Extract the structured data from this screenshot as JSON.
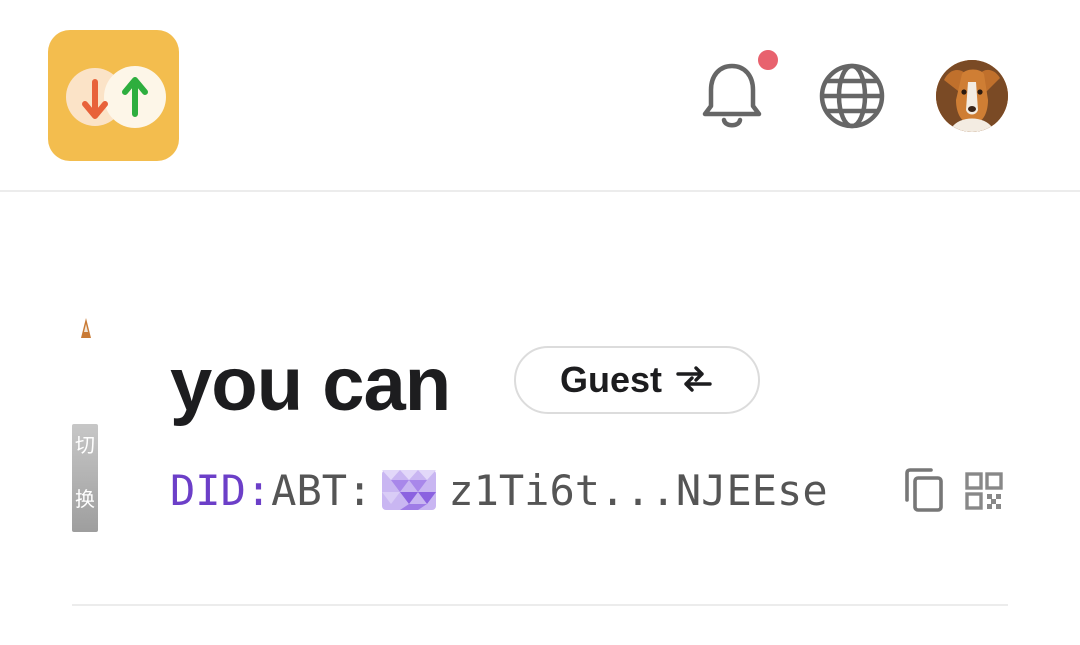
{
  "header": {
    "logo_icon": "swap-arrows-logo-icon",
    "notifications": {
      "icon": "bell-icon",
      "has_unread": true,
      "dot_color": "#e8626e"
    },
    "language": {
      "icon": "globe-icon"
    },
    "profile": {
      "icon": "user-avatar-dog"
    }
  },
  "user": {
    "name": "you can",
    "role_label": "Guest",
    "role_switch_icon": "swap-horizontal-icon",
    "did_prefix": "DID:",
    "did_type": "ABT:",
    "did_value": "z1Ti6t...NJEEse",
    "actions": {
      "copy_icon": "copy-icon",
      "qr_icon": "qr-code-icon"
    }
  },
  "side": {
    "glyphs": [
      "切",
      "换"
    ]
  },
  "colors": {
    "brand": "#f3bd4e",
    "did_accent": "#6c3fc8",
    "text_primary": "#1d1d1f",
    "text_secondary": "#555555",
    "divider": "#ececec"
  }
}
